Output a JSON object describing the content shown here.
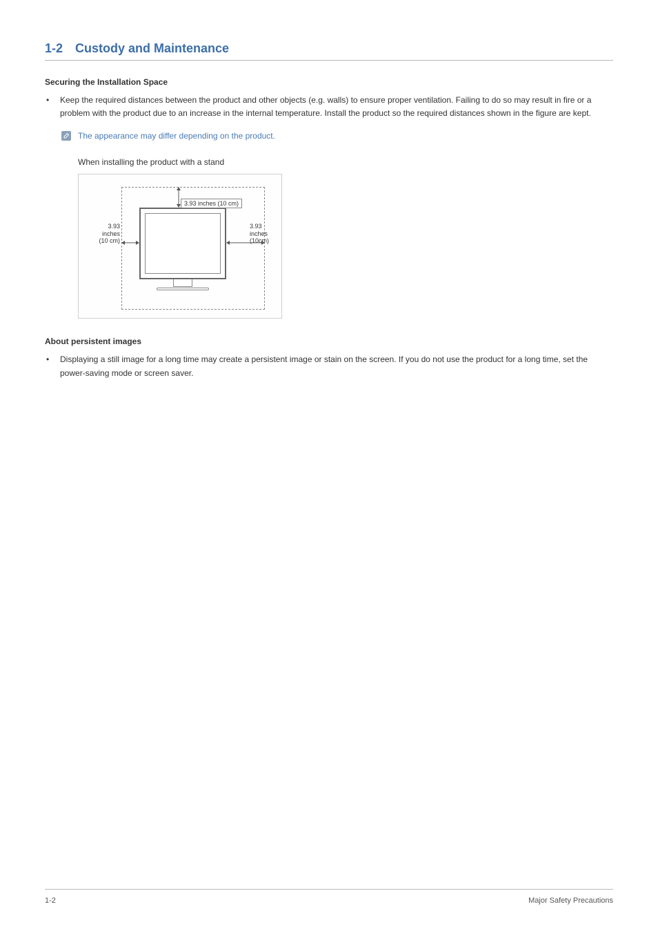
{
  "header": {
    "number": "1-2",
    "title": "Custody and Maintenance"
  },
  "section1": {
    "heading": "Securing the Installation Space",
    "bullet_text": "Keep the required distances between the product and other objects (e.g. walls) to ensure proper ventilation. Failing to do so may result in fire or a problem with the product due to an increase in the internal temperature. Install the product so the required distances shown in the figure are kept.",
    "note": "The appearance may differ depending on the product.",
    "figure_caption": "When installing the product with a stand",
    "dim_top": "3.93 inches (10 cm)",
    "dim_left_line1": "3.93 inches",
    "dim_left_line2": "(10 cm)",
    "dim_right_line1": "3.93 inches",
    "dim_right_line2": "(10cm)"
  },
  "section2": {
    "heading": "About persistent images",
    "bullet_text": "Displaying a still image for a long time may create a persistent image or stain on the screen. If you do not use the product for a long time, set the power-saving mode or screen saver."
  },
  "footer": {
    "left": "1-2",
    "right": "Major Safety Precautions"
  }
}
